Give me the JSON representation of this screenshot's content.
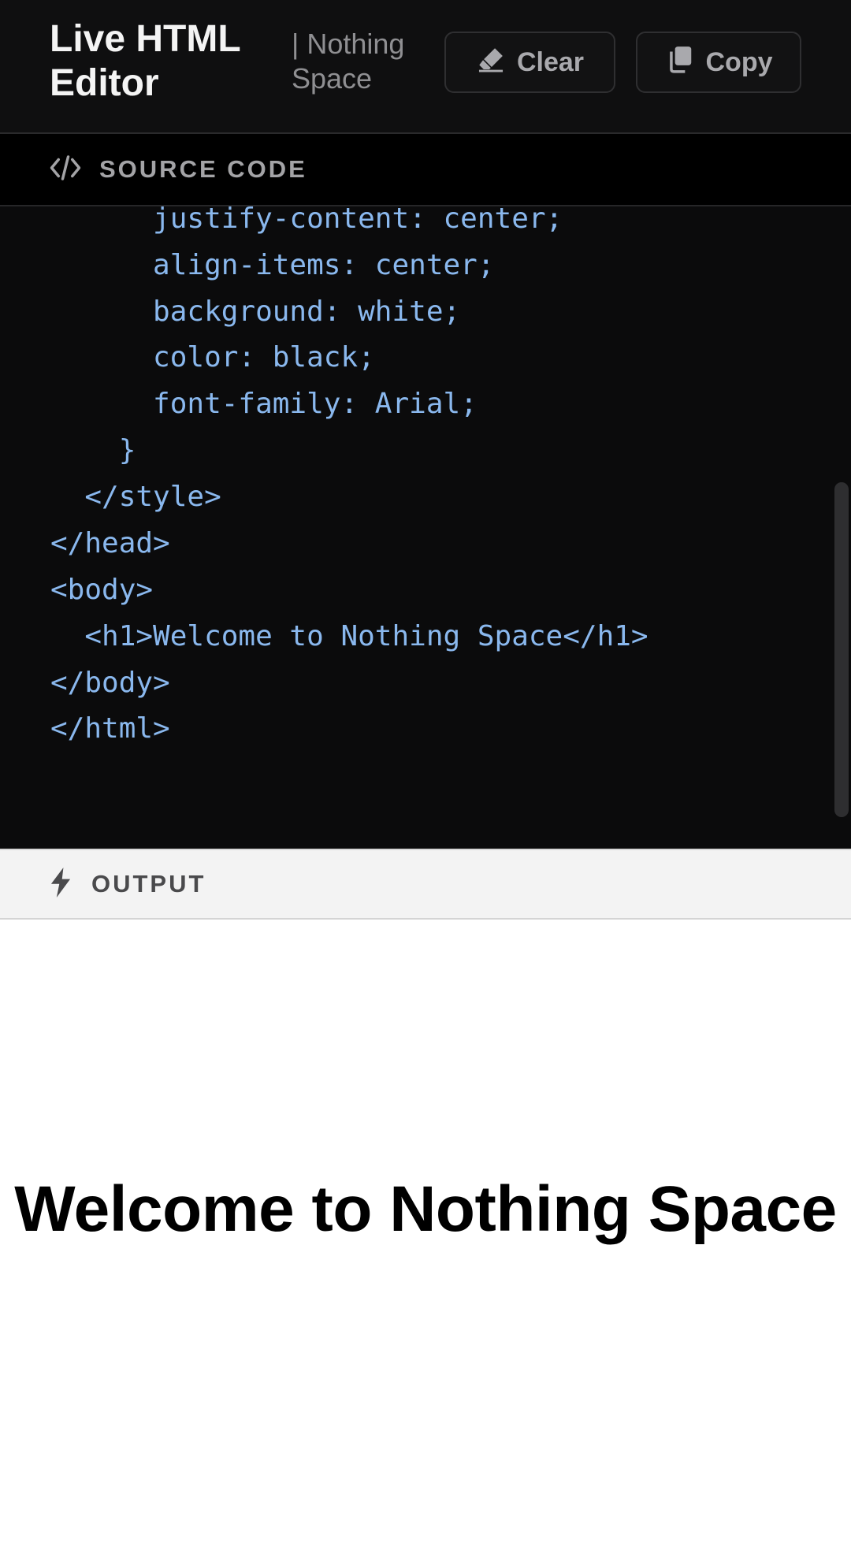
{
  "header": {
    "title": "Live HTML Editor",
    "subtitle": "| Nothing Space",
    "clear_label": "Clear",
    "copy_label": "Copy"
  },
  "source": {
    "label": "SOURCE CODE",
    "icon": "code-icon",
    "lines": [
      "      justify-content: center;",
      "      align-items: center;",
      "      background: white;",
      "      color: black;",
      "      font-family: Arial;",
      "    }",
      "  </style>",
      "</head>",
      "<body>",
      "  <h1>Welcome to Nothing Space</h1>",
      "</body>",
      "</html>"
    ]
  },
  "output": {
    "label": "OUTPUT",
    "icon": "bolt-icon",
    "heading": "Welcome to Nothing Space"
  },
  "colors": {
    "code_text": "#8ab8ee",
    "background": "#0b0b0c",
    "output_background": "#ffffff"
  }
}
